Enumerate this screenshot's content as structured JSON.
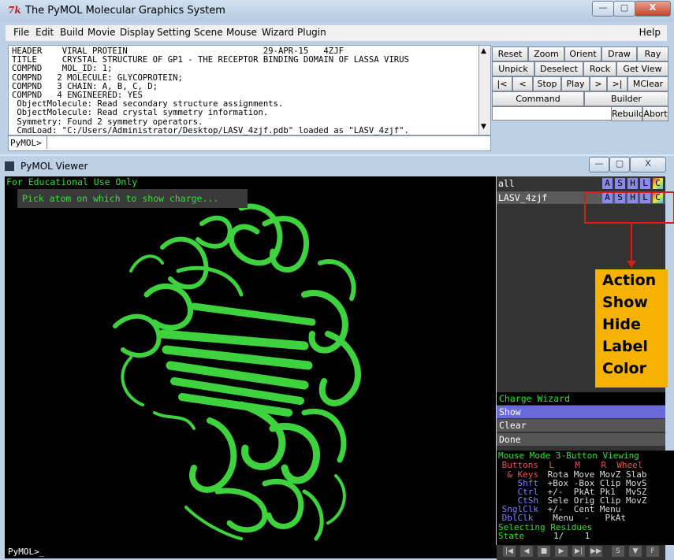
{
  "main_window": {
    "title": "The PyMOL Molecular Graphics System",
    "logo_text": "7k",
    "controls": {
      "minimize": "—",
      "maximize": "▢",
      "close": "X"
    }
  },
  "menu": [
    "File",
    "Edit",
    "Build",
    "Movie",
    "Display",
    "Setting",
    "Scene",
    "Mouse",
    "Wizard",
    "Plugin"
  ],
  "help_label": "Help",
  "log_lines": [
    "HEADER    VIRAL PROTEIN                           29-APR-15   4ZJF",
    "TITLE     CRYSTAL STRUCTURE OF GP1 - THE RECEPTOR BINDING DOMAIN OF LASSA VIRUS",
    "COMPND    MOL_ID: 1;",
    "COMPND   2 MOLECULE: GLYCOPROTEIN;",
    "COMPND   3 CHAIN: A, B, C, D;",
    "COMPND   4 ENGINEERED: YES",
    " ObjectMolecule: Read secondary structure assignments.",
    " ObjectMolecule: Read crystal symmetry information.",
    " Symmetry: Found 2 symmetry operators.",
    " CmdLoad: \"C:/Users/Administrator/Desktop/LASV_4zjf.pdb\" loaded as \"LASV_4zjf\"."
  ],
  "command_prompt": "PyMOL>",
  "buttons": {
    "row1": [
      "Reset",
      "Zoom",
      "Orient",
      "Draw",
      "Ray"
    ],
    "row2": [
      "Unpick",
      "Deselect",
      "Rock",
      "Get View"
    ],
    "row3": [
      "|<",
      "<",
      "Stop",
      "Play",
      ">",
      ">|",
      "MClear"
    ],
    "row4": [
      "Command",
      "Builder"
    ],
    "row5": [
      "Rebuild",
      "Abort"
    ]
  },
  "viewer_window": {
    "title": "PyMOL Viewer",
    "edu_text": "For Educational Use Only",
    "pick_message": "Pick atom on which to show charge...",
    "bottom_prompt": "PyMOL>_"
  },
  "objects": [
    {
      "name": "all",
      "buttons": [
        "A",
        "S",
        "H",
        "L",
        "C"
      ]
    },
    {
      "name": "LASV_4zjf",
      "buttons": [
        "A",
        "S",
        "H",
        "L",
        "C"
      ]
    }
  ],
  "annotation_labels": [
    "Action",
    "Show",
    "Hide",
    "Label",
    "Color"
  ],
  "wizard": {
    "title": "Charge Wizard",
    "items": [
      "Show",
      "Clear",
      "Done"
    ]
  },
  "mouse_mode": {
    "title": "Mouse Mode 3-Button Viewing",
    "header": " Buttons  L    M    R  Wheel",
    "rows": [
      {
        "key": "  & Keys",
        "vals": " Rota Move MovZ Slab"
      },
      {
        "key": "    Shft",
        "vals": " +Box -Box Clip MovS"
      },
      {
        "key": "    Ctrl",
        "vals": " +/-  PkAt Pk1  MvSZ"
      },
      {
        "key": "    CtSh",
        "vals": " Sele Orig Clip MovZ"
      },
      {
        "key": " SnglClk",
        "vals": " +/-  Cent Menu"
      },
      {
        "key": " DblClk",
        "vals": "  Menu  -   PkAt"
      }
    ],
    "selecting": "Selecting Residues",
    "state_label": "State",
    "state_value": "1/    1"
  },
  "transport_buttons": [
    "|◀",
    "◀",
    "■",
    "▶",
    "▶|",
    "▶▶",
    "S",
    "▼",
    "F"
  ],
  "colors": {
    "protein": "#3fd23f",
    "wizard_selected": "#6a6ae0",
    "annotation_red": "#e01818",
    "annotation_box": "#f6b200"
  }
}
